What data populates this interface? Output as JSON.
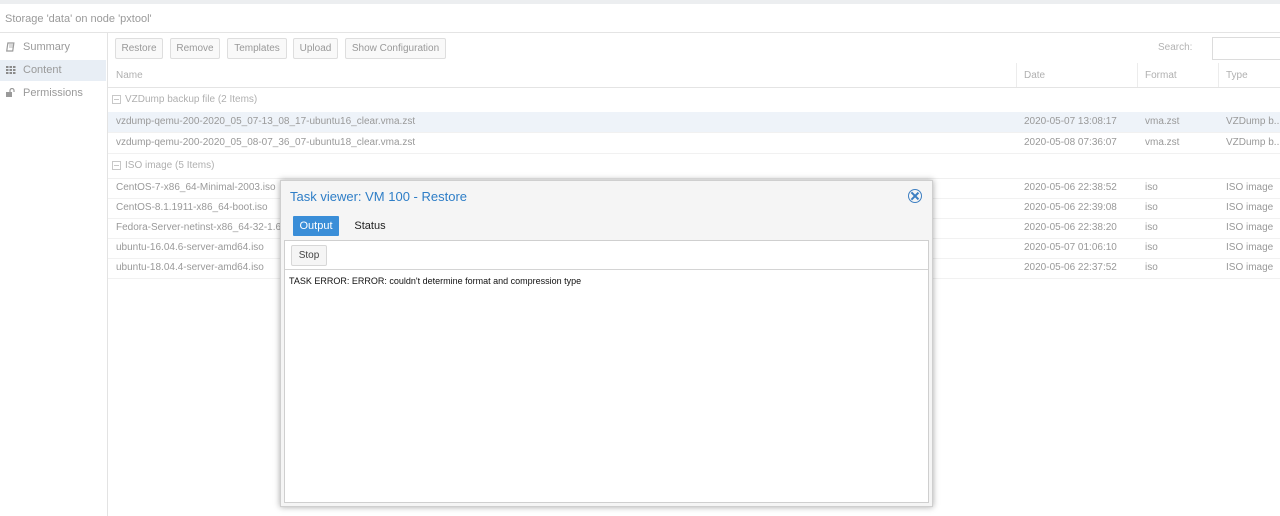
{
  "header": {
    "title": "Storage 'data' on node 'pxtool'"
  },
  "sidebar": {
    "items": [
      {
        "label": "Summary",
        "icon": "book-icon"
      },
      {
        "label": "Content",
        "icon": "grid-icon"
      },
      {
        "label": "Permissions",
        "icon": "unlock-icon"
      }
    ]
  },
  "toolbar": {
    "restore": "Restore",
    "remove": "Remove",
    "templates": "Templates",
    "upload": "Upload",
    "show_config": "Show Configuration",
    "search_label": "Search:",
    "search_value": ""
  },
  "grid": {
    "columns": {
      "name": "Name",
      "date": "Date",
      "format": "Format",
      "type": "Type"
    },
    "groups": [
      {
        "label": "VZDump backup file (2 Items)",
        "rows": [
          {
            "name": "vzdump-qemu-200-2020_05_07-13_08_17-ubuntu16_clear.vma.zst",
            "date": "2020-05-07 13:08:17",
            "format": "vma.zst",
            "type": "VZDump b..."
          },
          {
            "name": "vzdump-qemu-200-2020_05_08-07_36_07-ubuntu18_clear.vma.zst",
            "date": "2020-05-08 07:36:07",
            "format": "vma.zst",
            "type": "VZDump b..."
          }
        ]
      },
      {
        "label": "ISO image (5 Items)",
        "rows": [
          {
            "name": "CentOS-7-x86_64-Minimal-2003.iso",
            "date": "2020-05-06 22:38:52",
            "format": "iso",
            "type": "ISO image"
          },
          {
            "name": "CentOS-8.1.1911-x86_64-boot.iso",
            "date": "2020-05-06 22:39:08",
            "format": "iso",
            "type": "ISO image"
          },
          {
            "name": "Fedora-Server-netinst-x86_64-32-1.6.iso",
            "date": "2020-05-06 22:38:20",
            "format": "iso",
            "type": "ISO image"
          },
          {
            "name": "ubuntu-16.04.6-server-amd64.iso",
            "date": "2020-05-07 01:06:10",
            "format": "iso",
            "type": "ISO image"
          },
          {
            "name": "ubuntu-18.04.4-server-amd64.iso",
            "date": "2020-05-06 22:37:52",
            "format": "iso",
            "type": "ISO image"
          }
        ]
      }
    ]
  },
  "modal": {
    "title": "Task viewer: VM 100 - Restore",
    "tabs": [
      "Output",
      "Status"
    ],
    "stop_label": "Stop",
    "log": [
      "TASK ERROR: ERROR: couldn't determine format and compression type"
    ]
  },
  "colors": {
    "accent": "#3a8ed8",
    "title_blue": "#2e7ec7",
    "selected_row": "#eef3f9"
  }
}
